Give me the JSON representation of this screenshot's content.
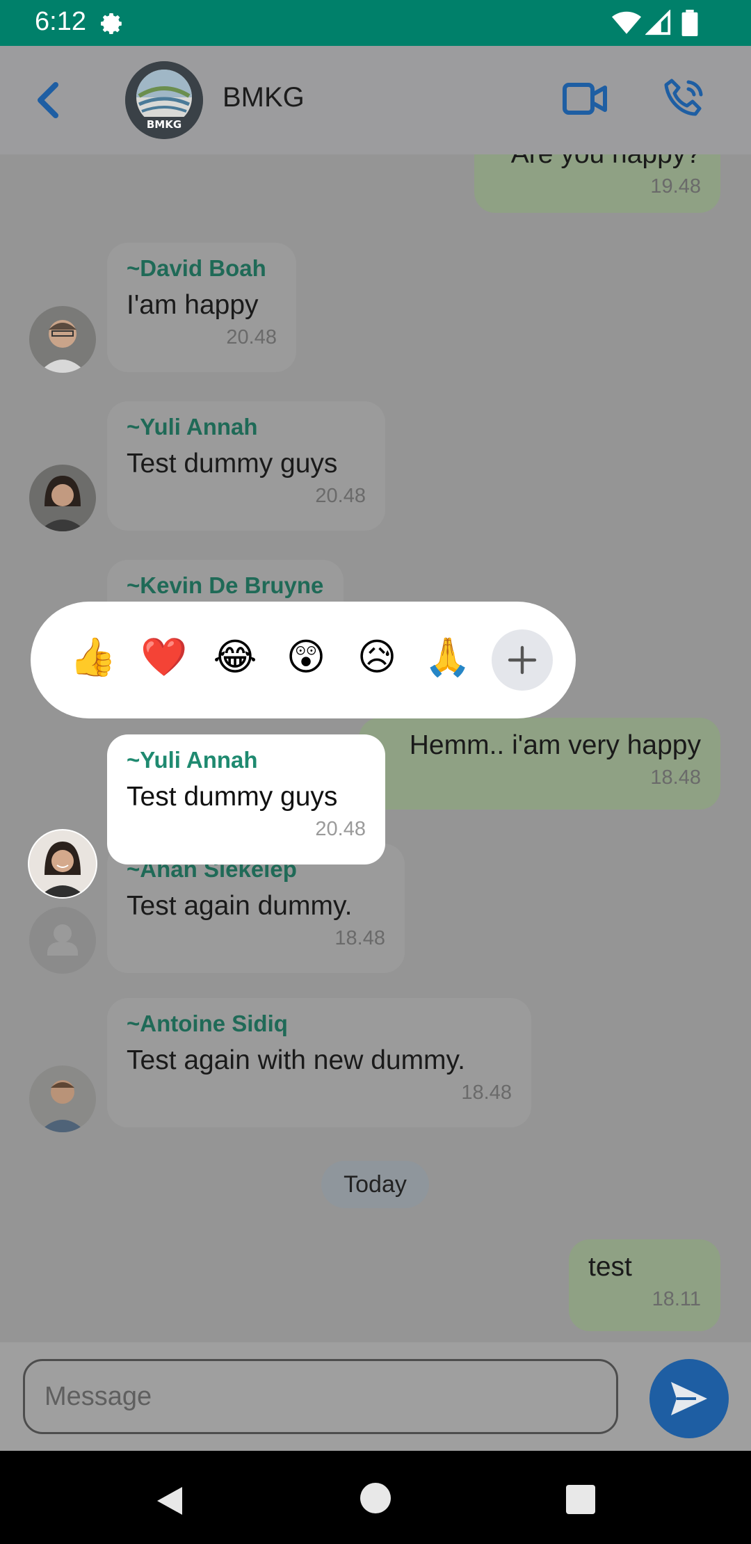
{
  "status_bar": {
    "time": "6:12",
    "icons": [
      "settings-icon",
      "wifi-icon",
      "signal-icon",
      "battery-icon"
    ]
  },
  "header": {
    "title": "BMKG",
    "avatar_text": "BMKG"
  },
  "messages": [
    {
      "direction": "out",
      "text": "Are you happy?",
      "time": "19.48"
    },
    {
      "direction": "in",
      "sender": "~David Boah",
      "text": "I'am happy",
      "time": "20.48"
    },
    {
      "direction": "in",
      "sender": "~Yuli Annah",
      "text": "Test dummy guys",
      "time": "20.48"
    },
    {
      "direction": "in",
      "sender": "~Kevin De Bruyne"
    },
    {
      "direction": "out",
      "text": "Hemm.. i'am very happy",
      "time": "18.48"
    },
    {
      "direction": "in",
      "sender": "~Ahan Siekeiep",
      "text": "Test again dummy.",
      "time": "18.48"
    },
    {
      "direction": "in",
      "sender": "~Antoine Sidiq",
      "text": "Test again with new dummy.",
      "time": "18.48"
    },
    {
      "direction": "out",
      "text": "test",
      "time": "18.11"
    }
  ],
  "date_separator": "Today",
  "reactions": [
    "👍",
    "❤️",
    "😂",
    "😲",
    "😥",
    "🙏"
  ],
  "selected_message": {
    "sender": "~Yuli Annah",
    "text": "Test dummy guys",
    "time": "20.48"
  },
  "input": {
    "placeholder": "Message"
  },
  "colors": {
    "status_bar": "#00806a",
    "accent": "#1e5ea3",
    "sender": "#1f8a70"
  }
}
